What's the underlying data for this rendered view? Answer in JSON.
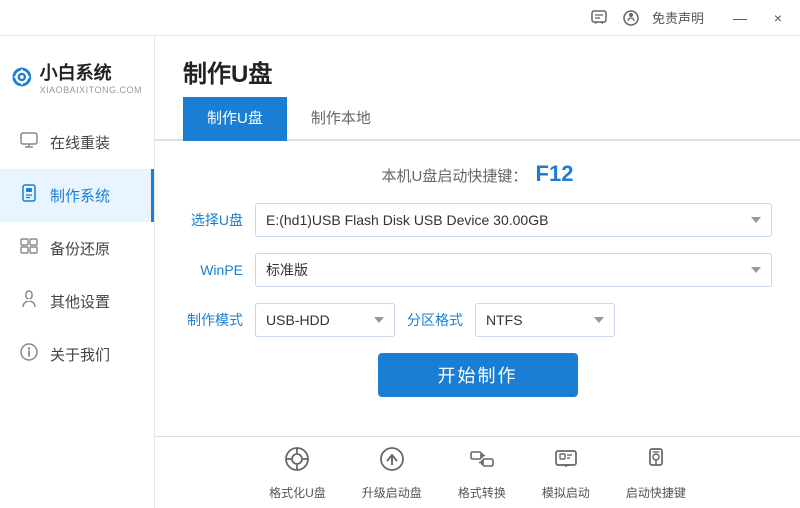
{
  "titlebar": {
    "feedback_label": "免责声明",
    "minimize_label": "—",
    "close_label": "×"
  },
  "sidebar": {
    "logo_name": "小白系统",
    "logo_sub": "XIAOBAIXITONG.COM",
    "items": [
      {
        "id": "online-reinstall",
        "label": "在线重装",
        "icon": "🖥"
      },
      {
        "id": "make-system",
        "label": "制作系统",
        "icon": "💾",
        "active": true
      },
      {
        "id": "backup-restore",
        "label": "备份还原",
        "icon": "📋"
      },
      {
        "id": "other-settings",
        "label": "其他设置",
        "icon": "🔒"
      },
      {
        "id": "about-us",
        "label": "关于我们",
        "icon": "ℹ"
      }
    ]
  },
  "page": {
    "title": "制作U盘",
    "tabs": [
      {
        "id": "make-udisk",
        "label": "制作U盘",
        "active": true
      },
      {
        "id": "make-local",
        "label": "制作本地",
        "active": false
      }
    ],
    "shortcut_prefix": "本机U盘启动快捷键：",
    "shortcut_key": "F12",
    "form": {
      "select_udisk_label": "选择U盘",
      "select_udisk_value": "E:(hd1)USB Flash Disk USB Device 30.00GB",
      "winpe_label": "WinPE",
      "winpe_value": "标准版",
      "make_mode_label": "制作模式",
      "make_mode_value": "USB-HDD",
      "partition_label": "分区格式",
      "partition_value": "NTFS",
      "start_btn_label": "开始制作"
    },
    "bottom_tools": [
      {
        "id": "format-udisk",
        "icon": "⊙",
        "label": "格式化U盘"
      },
      {
        "id": "upgrade-boot",
        "icon": "⊕",
        "label": "升级启动盘"
      },
      {
        "id": "format-convert",
        "icon": "⇄",
        "label": "格式转换"
      },
      {
        "id": "simulate-boot",
        "icon": "⊞",
        "label": "模拟启动"
      },
      {
        "id": "boot-shortcut",
        "icon": "🔑",
        "label": "启动快捷键"
      }
    ]
  }
}
